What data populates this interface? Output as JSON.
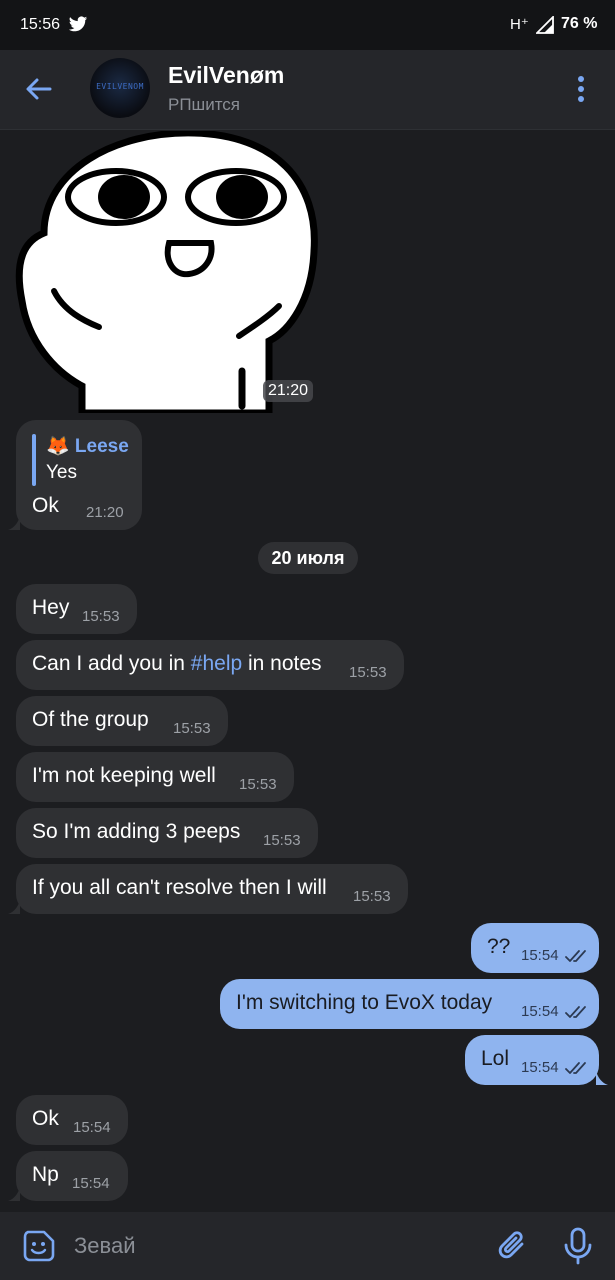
{
  "status_bar": {
    "time": "15:56",
    "network": "H⁺",
    "battery": "76 %"
  },
  "header": {
    "title": "EvilVenøm",
    "subtitle": "РПшится",
    "avatar_text": "EVILVENOM"
  },
  "sticker": {
    "time": "21:20"
  },
  "reply_message": {
    "reply_to_name": "🦊 Leese",
    "reply_to_text": "Yes",
    "text": "Ok",
    "time": "21:20"
  },
  "date_separator": "20 июля",
  "incoming_block_1": [
    {
      "text": "Hey",
      "time": "15:53"
    },
    {
      "text_before": "Can I add you in ",
      "hashtag": "#help",
      "text_after": " in notes",
      "time": "15:53"
    },
    {
      "text": "Of the group",
      "time": "15:53"
    },
    {
      "text": "I'm not keeping well",
      "time": "15:53"
    },
    {
      "text": "So I'm adding 3 peeps",
      "time": "15:53"
    },
    {
      "text": "If you all can't resolve then I will",
      "time": "15:53"
    }
  ],
  "outgoing": [
    {
      "text": "??",
      "time": "15:54"
    },
    {
      "text": "I'm switching to EvoX today",
      "time": "15:54"
    },
    {
      "text": "Lol",
      "time": "15:54"
    }
  ],
  "incoming_block_2": [
    {
      "text": "Ok",
      "time": "15:54"
    },
    {
      "text": "Np",
      "time": "15:54"
    }
  ],
  "input": {
    "placeholder": "Зевай"
  },
  "colors": {
    "accent": "#7aa7f2",
    "outgoing_bubble": "#8fb4ef",
    "incoming_bubble": "#2f3033",
    "background": "#1c1d20"
  },
  "icons": [
    "twitter-icon",
    "signal-icon",
    "back-icon",
    "more-icon",
    "sticker-icon",
    "attach-icon",
    "mic-icon",
    "double-check-icon"
  ]
}
